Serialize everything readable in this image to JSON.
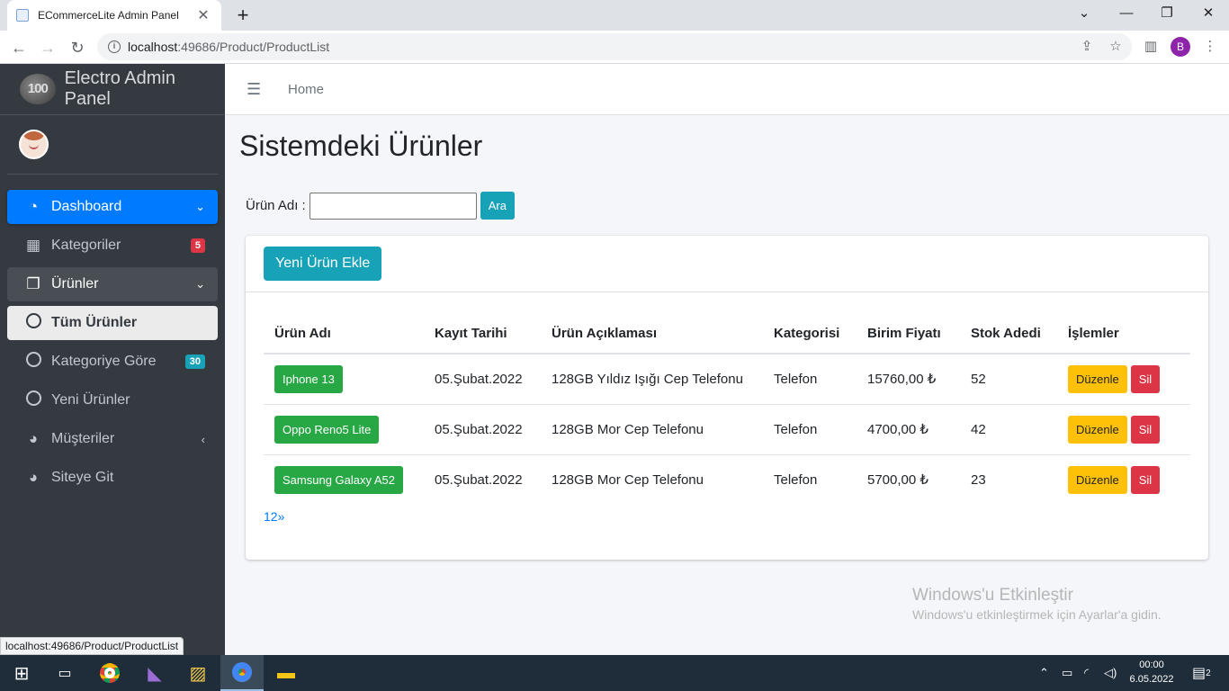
{
  "browser": {
    "tab_title": "ECommerceLite Admin Panel",
    "url_host": "localhost",
    "url_path": ":49686/Product/ProductList",
    "profile_initial": "B",
    "status_url": "localhost:49686/Product/ProductList"
  },
  "sidebar": {
    "brand_logo": "100",
    "brand_name": "Electro Admin Panel",
    "items": [
      {
        "label": "Dashboard",
        "icon": "tachometer-icon"
      },
      {
        "label": "Kategoriler",
        "icon": "grid-icon",
        "badge": "5"
      },
      {
        "label": "Ürünler",
        "icon": "copy-icon"
      },
      {
        "label": "Tüm Ürünler",
        "icon": "circle-icon"
      },
      {
        "label": "Kategoriye Göre",
        "icon": "circle-icon",
        "badge": "30"
      },
      {
        "label": "Yeni Ürünler",
        "icon": "circle-icon"
      },
      {
        "label": "Müşteriler",
        "icon": "chart-pie-icon"
      },
      {
        "label": "Siteye Git",
        "icon": "chart-pie-icon"
      }
    ]
  },
  "topnav": {
    "home": "Home"
  },
  "page": {
    "title": "Sistemdeki Ürünler",
    "search_label": "Ürün Adı :",
    "search_value": "",
    "search_button": "Ara",
    "add_button": "Yeni Ürün Ekle"
  },
  "table": {
    "headers": [
      "Ürün Adı",
      "Kayıt Tarihi",
      "Ürün Açıklaması",
      "Kategorisi",
      "Birim Fiyatı",
      "Stok Adedi",
      "İşlemler"
    ],
    "rows": [
      {
        "name": "Iphone 13",
        "date": "05.Şubat.2022",
        "desc": "128GB Yıldız Işığı Cep Telefonu",
        "category": "Telefon",
        "price": "15760,00 ₺",
        "stock": "52"
      },
      {
        "name": "Oppo Reno5 Lite",
        "date": "05.Şubat.2022",
        "desc": "128GB Mor Cep Telefonu",
        "category": "Telefon",
        "price": "4700,00 ₺",
        "stock": "42"
      },
      {
        "name": "Samsung Galaxy A52",
        "date": "05.Şubat.2022",
        "desc": "128GB Mor Cep Telefonu",
        "category": "Telefon",
        "price": "5700,00 ₺",
        "stock": "23"
      }
    ],
    "edit_label": "Düzenle",
    "delete_label": "Sil",
    "pager": [
      "1",
      "2",
      "»"
    ]
  },
  "watermark": {
    "line1": "Windows'u Etkinleştir",
    "line2": "Windows'u etkinleştirmek için Ayarlar'a gidin."
  },
  "taskbar": {
    "time": "00:00",
    "date": "6.05.2022",
    "notification_count": "2"
  },
  "colors": {
    "primary": "#007bff",
    "info": "#17a2b8",
    "success": "#28a745",
    "warning": "#ffc107",
    "danger": "#dc3545",
    "sidebar": "#343a40"
  }
}
